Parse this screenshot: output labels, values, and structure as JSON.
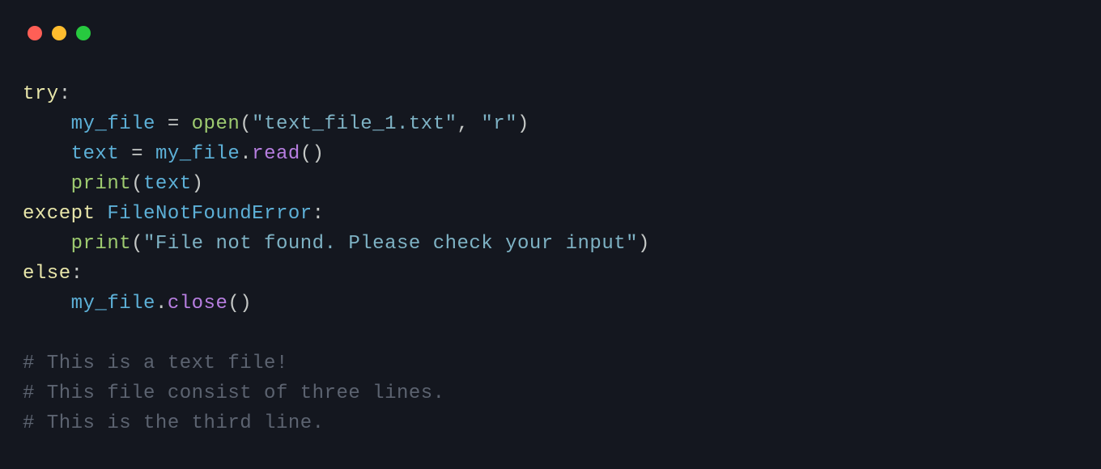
{
  "code": {
    "line1": {
      "kw": "try",
      "colon": ":"
    },
    "line2": {
      "indent": "    ",
      "var": "my_file",
      "op": " = ",
      "func": "open",
      "lpar": "(",
      "str1": "\"text_file_1.txt\"",
      "comma": ", ",
      "str2": "\"r\"",
      "rpar": ")"
    },
    "line3": {
      "indent": "    ",
      "var1": "text",
      "op": " = ",
      "var2": "my_file",
      "dot": ".",
      "method": "read",
      "parens": "()"
    },
    "line4": {
      "indent": "    ",
      "func": "print",
      "lpar": "(",
      "var": "text",
      "rpar": ")"
    },
    "line5": {
      "kw": "except",
      "space": " ",
      "cls": "FileNotFoundError",
      "colon": ":"
    },
    "line6": {
      "indent": "    ",
      "func": "print",
      "lpar": "(",
      "str": "\"File not found. Please check your input\"",
      "rpar": ")"
    },
    "line7": {
      "kw": "else",
      "colon": ":"
    },
    "line8": {
      "indent": "    ",
      "var": "my_file",
      "dot": ".",
      "method": "close",
      "parens": "()"
    },
    "line9": "# This is a text file!",
    "line10": "# This file consist of three lines.",
    "line11": "# This is the third line."
  }
}
